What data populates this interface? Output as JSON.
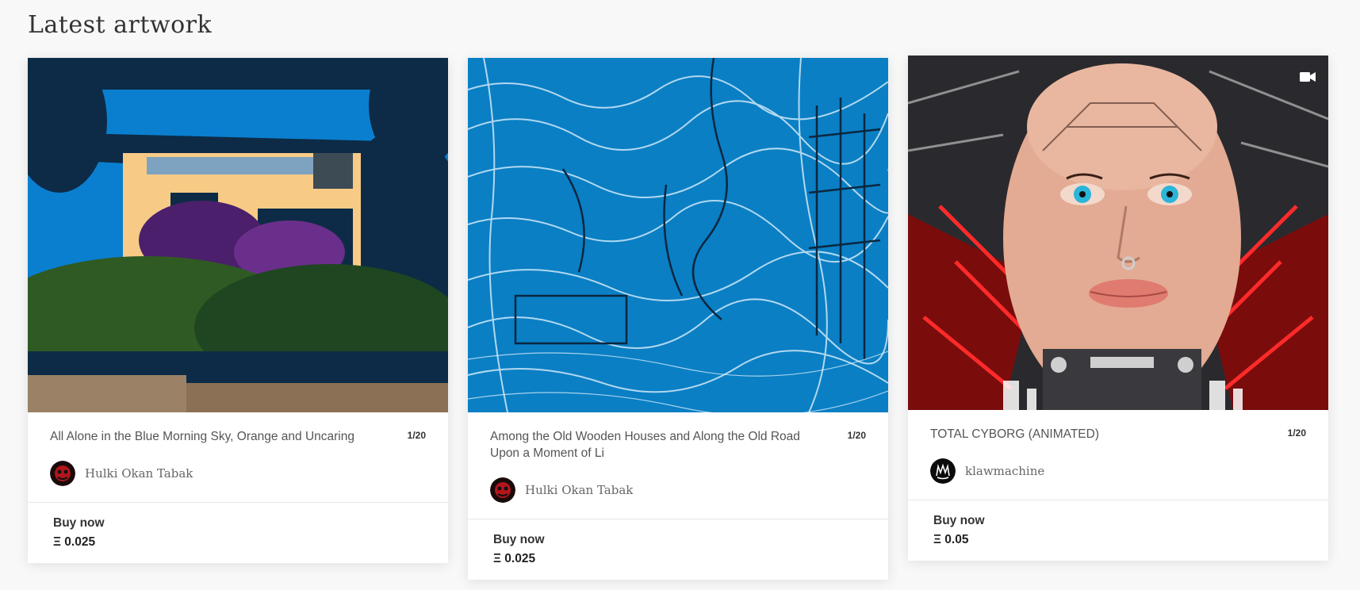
{
  "section": {
    "title": "Latest artwork"
  },
  "cards": [
    {
      "title": "All Alone in the Blue Morning Sky, Orange and Uncaring",
      "edition": "1/20",
      "artist": "Hulki Okan Tabak",
      "buy_label": "Buy now",
      "price": "Ξ 0.025",
      "art_icon": "house-artwork",
      "avatar_icon": "red-mask-avatar"
    },
    {
      "title": "Among the Old Wooden Houses and Along the Old Road Upon a Moment of Li",
      "edition": "1/20",
      "artist": "Hulki Okan Tabak",
      "buy_label": "Buy now",
      "price": "Ξ 0.025",
      "art_icon": "blue-sketch-artwork",
      "avatar_icon": "red-mask-avatar"
    },
    {
      "title": "TOTAL CYBORG (ANIMATED)",
      "edition": "1/20",
      "artist": "klawmachine",
      "buy_label": "Buy now",
      "price": "Ξ 0.05",
      "art_icon": "cyborg-artwork",
      "avatar_icon": "klaw-logo-avatar",
      "badge_icon": "video-camera-icon"
    }
  ],
  "colors": {
    "accent_blue": "#0a7fc4",
    "navy": "#0d2b46",
    "cyborg_red": "#ff2a2a"
  }
}
